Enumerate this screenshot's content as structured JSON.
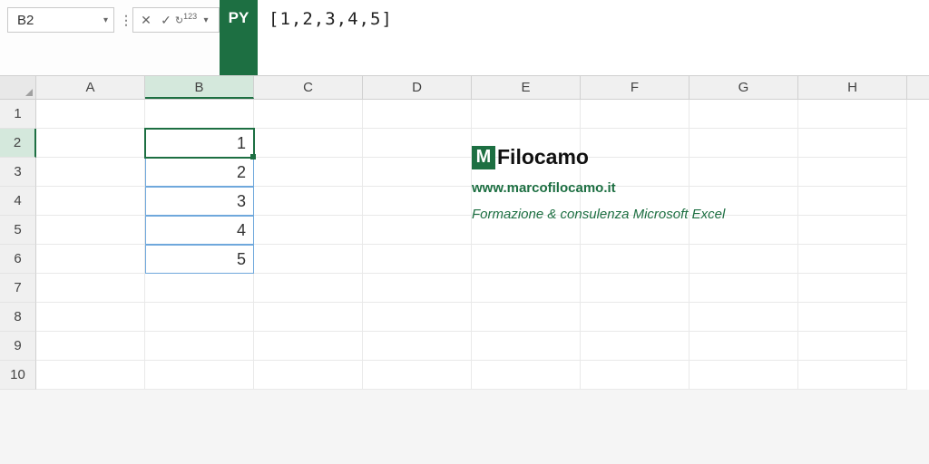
{
  "formula_bar": {
    "name_box_value": "B2",
    "py_badge": "PY",
    "formula_text": "[1,2,3,4,5]"
  },
  "columns": [
    "A",
    "B",
    "C",
    "D",
    "E",
    "F",
    "G",
    "H"
  ],
  "active_column": "B",
  "rows": [
    "1",
    "2",
    "3",
    "4",
    "5",
    "6",
    "7",
    "8",
    "9",
    "10"
  ],
  "active_row": "2",
  "cells": {
    "B2": "1",
    "B3": "2",
    "B4": "3",
    "B5": "4",
    "B6": "5"
  },
  "brand": {
    "logo_letter": "M",
    "name": "Filocamo",
    "url": "www.marcofilocamo.it",
    "tagline": "Formazione & consulenza Microsoft Excel"
  }
}
